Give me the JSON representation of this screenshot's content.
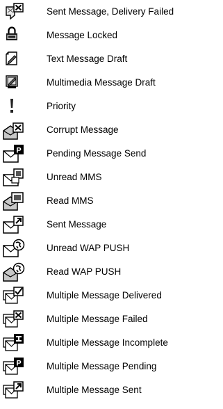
{
  "legend": {
    "items": [
      {
        "icon": "sent-failed-icon",
        "label": "Sent Message, Delivery Failed"
      },
      {
        "icon": "lock-icon",
        "label": "Message Locked"
      },
      {
        "icon": "text-draft-icon",
        "label": "Text Message Draft"
      },
      {
        "icon": "mms-draft-icon",
        "label": "Multimedia Message Draft"
      },
      {
        "icon": "priority-icon",
        "label": "Priority"
      },
      {
        "icon": "corrupt-envelope-icon",
        "label": "Corrupt Message"
      },
      {
        "icon": "pending-envelope-icon",
        "label": "Pending Message Send"
      },
      {
        "icon": "unread-mms-icon",
        "label": "Unread MMS"
      },
      {
        "icon": "read-mms-icon",
        "label": "Read MMS"
      },
      {
        "icon": "sent-envelope-icon",
        "label": "Sent Message"
      },
      {
        "icon": "unread-wap-push-icon",
        "label": "Unread WAP PUSH"
      },
      {
        "icon": "read-wap-push-icon",
        "label": "Read WAP PUSH"
      },
      {
        "icon": "multiple-delivered-icon",
        "label": "Multiple Message Delivered"
      },
      {
        "icon": "multiple-failed-icon",
        "label": "Multiple Message Failed"
      },
      {
        "icon": "multiple-incomplete-icon",
        "label": "Multiple Message Incomplete"
      },
      {
        "icon": "multiple-pending-icon",
        "label": "Multiple Message Pending"
      },
      {
        "icon": "multiple-sent-icon",
        "label": "Multiple Message Sent"
      }
    ]
  }
}
